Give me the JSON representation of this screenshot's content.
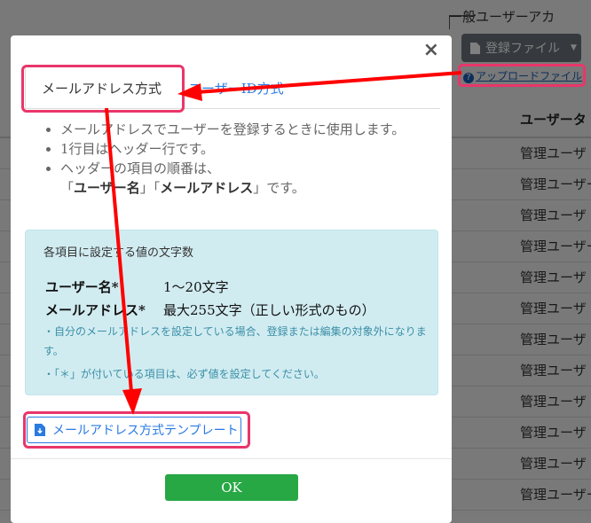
{
  "background": {
    "title": "一般ユーザーアカ",
    "register_button": "登録ファイル",
    "upload_link": "アップロードファイル",
    "table_header": "ユーザータ",
    "rows": [
      "管理ユーザ",
      "管理ユーザー",
      "管理ユーザ",
      "管理ユーザー",
      "管理ユーザ",
      "管理ユーザ",
      "管理ユーザ",
      "管理ユーザ",
      "管理ユーザ",
      "管理ユーザ",
      "管理ユーザ",
      "管理ユーザー"
    ]
  },
  "modal": {
    "close": "×",
    "tab_active": "メールアドレス方式",
    "tab_other": "ユーザーID方式",
    "notes": [
      "メールアドレスでユーザーを登録するときに使用します。",
      "1行目はヘッダー行です。",
      "ヘッダーの項目の順番は、"
    ],
    "note_order": {
      "q1": "「",
      "a": "ユーザー名",
      "mid": "」「",
      "b": "メールアドレス",
      "q2": "」です。"
    },
    "info": {
      "title": "各項目に設定する値の文字数",
      "user_label": "ユーザー名*",
      "user_value": "1〜20文字",
      "email_label": "メールアドレス*",
      "email_value": "最大255文字（正しい形式のもの）",
      "note1": "・自分のメールアドレスを設定している場合、登録または編集の対象外になります。",
      "note2": "・「＊」が付いている項目は、必ず値を設定してください。"
    },
    "template_button": "メールアドレス方式テンプレート",
    "ok_button": "OK"
  },
  "colors": {
    "highlight": "#e9366b",
    "arrow": "#ff0000",
    "ok": "#28a745",
    "link": "#2a7ae2",
    "info_bg": "#d1ecf1"
  }
}
